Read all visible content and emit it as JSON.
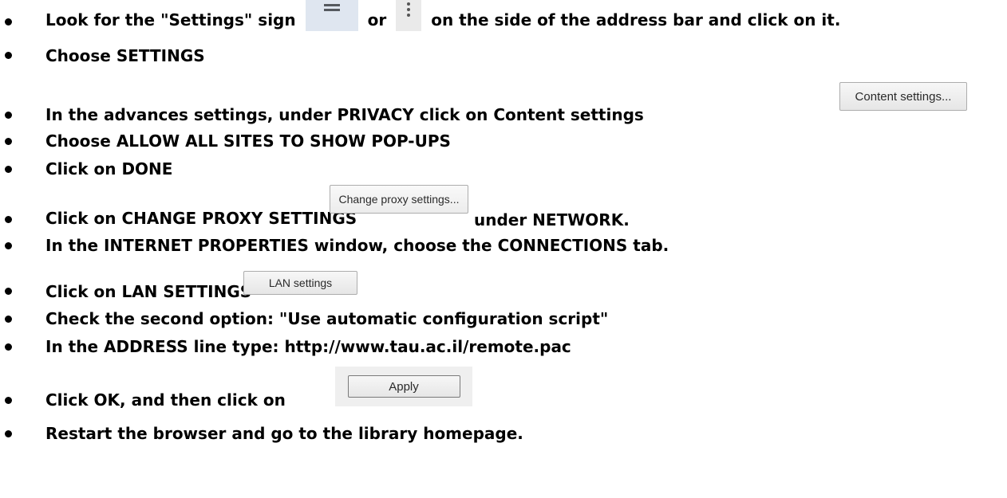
{
  "steps": [
    {
      "text_before": "Look for the \"Settings\" sign",
      "text_middle": "or",
      "text_after": "on the side of the address bar and click on it."
    },
    {
      "text": "Choose SETTINGS"
    },
    {
      "text": "In the advances settings, under PRIVACY click on Content settings",
      "button_label": "Content settings..."
    },
    {
      "text": "Choose ALLOW ALL SITES TO SHOW POP-UPS"
    },
    {
      "text": "Click on DONE"
    },
    {
      "text_before": "Click on CHANGE PROXY SETTINGS",
      "button_label": "Change proxy settings...",
      "text_after": "under NETWORK."
    },
    {
      "text": "In the INTERNET PROPERTIES window, choose the CONNECTIONS tab."
    },
    {
      "text": "Click on LAN SETTINGS",
      "button_label": "LAN settings"
    },
    {
      "text": "Check the second option: \"Use automatic configuration script\""
    },
    {
      "text": "In the ADDRESS line type: http://www.tau.ac.il/remote.pac"
    },
    {
      "text": "Click OK, and then click on",
      "button_label": "Apply"
    },
    {
      "text": "Restart the browser and go to the library homepage."
    }
  ],
  "icons": {
    "settings_menu": "hamburger-menu-icon",
    "more_options": "vertical-dots-icon"
  }
}
